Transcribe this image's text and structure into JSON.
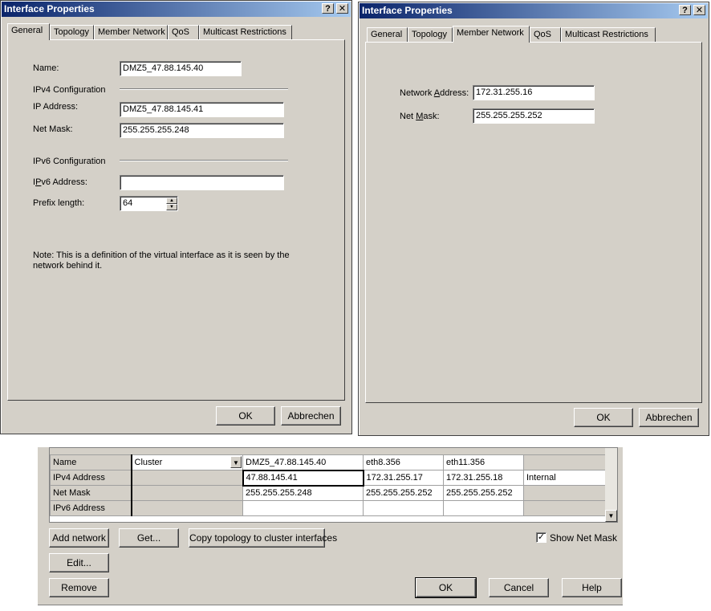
{
  "dialog1": {
    "title": "Interface Properties",
    "help_btn": "?",
    "close_btn": "✕",
    "tabs": [
      "General",
      "Topology",
      "Member Network",
      "QoS",
      "Multicast Restrictions"
    ],
    "active_tab": "General",
    "name_label": "Name:",
    "name_value": "DMZ5_47.88.145.40",
    "ipv4_section": "IPv4 Configuration",
    "ip_label": "IP Address:",
    "ip_value": "DMZ5_47.88.145.41",
    "mask_label": "Net Mask:",
    "mask_value": "255.255.255.248",
    "ipv6_section": "IPv6 Configuration",
    "ipv6_label_pre": "I",
    "ipv6_label_u": "P",
    "ipv6_label_post": "v6 Address:",
    "ipv6_value": "",
    "prefix_label": "Prefix length:",
    "prefix_value": "64",
    "note": "Note: This is a definition of the virtual interface as it is seen by the network behind it.",
    "ok": "OK",
    "cancel": "Abbrechen"
  },
  "dialog2": {
    "title": "Interface Properties",
    "help_btn": "?",
    "close_btn": "✕",
    "tabs": [
      "General",
      "Topology",
      "Member Network",
      "QoS",
      "Multicast Restrictions"
    ],
    "active_tab": "Member Network",
    "netaddr_label_pre": "Network ",
    "netaddr_label_u": "A",
    "netaddr_label_post": "ddress:",
    "netaddr_value": "172.31.255.16",
    "netmask_label_pre": "Net ",
    "netmask_label_u": "M",
    "netmask_label_post": "ask:",
    "netmask_value": "255.255.255.252",
    "ok": "OK",
    "cancel": "Abbrechen"
  },
  "cluster": {
    "rows": [
      {
        "header": "Name",
        "type": "Cluster",
        "c1": "DMZ5_47.88.145.40",
        "c2": "eth8.356",
        "c3": "eth11.356",
        "c4": ""
      },
      {
        "header": "IPv4 Address",
        "type": "",
        "c1": "47.88.145.41",
        "c2": "172.31.255.17",
        "c3": "172.31.255.18",
        "c4": "Internal"
      },
      {
        "header": "Net Mask",
        "type": "",
        "c1": "255.255.255.248",
        "c2": "255.255.255.252",
        "c3": "255.255.255.252",
        "c4": ""
      },
      {
        "header": "IPv6 Address",
        "type": "",
        "c1": "",
        "c2": "",
        "c3": "",
        "c4": ""
      }
    ],
    "add_network": "Add network",
    "get": "Get...",
    "copy_topology": "Copy topology to cluster interfaces",
    "show_net_mask": "Show Net Mask",
    "show_net_mask_checked": "✓",
    "edit": "Edit...",
    "remove": "Remove",
    "ok": "OK",
    "cancel": "Cancel",
    "help": "Help",
    "scroll_down": "▼",
    "dropdown_arrow": "▼"
  }
}
